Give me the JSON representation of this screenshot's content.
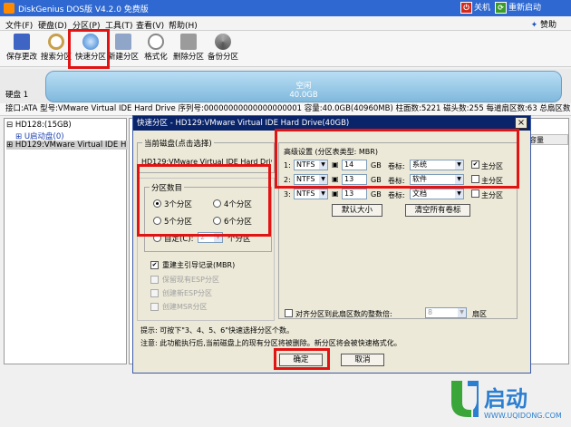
{
  "app": {
    "title": "DiskGenius DOS版 V4.2.0 免费版",
    "shutdown": "关机",
    "reboot": "重新启动",
    "sponsor": "赞助"
  },
  "menu": [
    "文件(F)",
    "硬盘(D)",
    "分区(P)",
    "工具(T)",
    "查看(V)",
    "帮助(H)"
  ],
  "toolbar": [
    "保存更改",
    "搜索分区",
    "快速分区",
    "新建分区",
    "格式化",
    "删除分区",
    "备份分区"
  ],
  "disk": {
    "label": "硬盘 1",
    "graphic_line1": "空闲",
    "graphic_line2": "40.0GB",
    "info": "接口:ATA   型号:VMware Virtual IDE Hard Drive   序列号:00000000000000000001   容量:40.0GB(40960MB)   柱面数:5221   磁头数:255   每道扇区数:63   总扇区数:"
  },
  "tree": {
    "item1": "HD128:(15GB)",
    "item2": "U启动盘(0)",
    "item3": "HD129:VMware Virtual IDE H"
  },
  "right_header": "容量",
  "dialog": {
    "title": "快速分区 - HD129:VMware Virtual IDE Hard Drive(40GB)",
    "close": "×",
    "current_disk_label": "当前磁盘(点击选择)",
    "current_disk_value": "HD129:VMware Virtual IDE Hard Driv",
    "count_group": "分区数目",
    "count_options": [
      "3个分区",
      "4个分区",
      "5个分区",
      "6个分区"
    ],
    "custom_label": "自定(C):",
    "custom_value": "2",
    "custom_suffix": "个分区",
    "rebuild_mbr": "重建主引导记录(MBR)",
    "keep_esp": "保留现有ESP分区",
    "create_esp": "创建新ESP分区",
    "create_msr": "创建MSR分区",
    "adv_title": "高级设置 (分区表类型: MBR)",
    "rows": [
      {
        "num": "1:",
        "fs": "NTFS",
        "size": "14",
        "unit": "GB",
        "vl": "卷标:",
        "vol": "系统",
        "primary": "主分区",
        "checked": true
      },
      {
        "num": "2:",
        "fs": "NTFS",
        "size": "13",
        "unit": "GB",
        "vl": "卷标:",
        "vol": "软件",
        "primary": "主分区",
        "checked": false
      },
      {
        "num": "3:",
        "fs": "NTFS",
        "size": "13",
        "unit": "GB",
        "vl": "卷标:",
        "vol": "文档",
        "primary": "主分区",
        "checked": false
      }
    ],
    "default_size": "默认大小",
    "clear_labels": "清空所有卷标",
    "align_label": "对齐分区到此扇区数的整数倍:",
    "align_value": "8",
    "align_unit": "扇区",
    "tip": "提示: 可按下\"3、4、5、6\"快速选择分区个数。",
    "note": "注意: 此功能执行后,当前磁盘上的现有分区将被删除。新分区将会被快速格式化。",
    "ok": "确定",
    "cancel": "取消"
  },
  "logo": {
    "brand": "启动",
    "url": "WWW.UQIDONG.COM"
  }
}
